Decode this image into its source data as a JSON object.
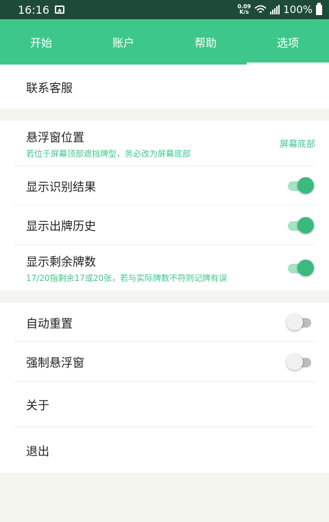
{
  "status_bar": {
    "time": "16:16",
    "speed_value": "0.09",
    "speed_unit": "K/s",
    "battery": "100%"
  },
  "tabs": [
    {
      "label": "开始"
    },
    {
      "label": "账户"
    },
    {
      "label": "帮助"
    },
    {
      "label": "选项"
    }
  ],
  "active_tab": 3,
  "section1": {
    "contact": "联系客服"
  },
  "section2": {
    "position_title": "悬浮窗位置",
    "position_hint": "若位于屏幕顶部遮挡牌型，务必改为屏幕底部",
    "position_value": "屏幕底部",
    "show_result": "显示识别结果",
    "show_result_on": true,
    "show_history": "显示出牌历史",
    "show_history_on": true,
    "show_remaining": "显示剩余牌数",
    "show_remaining_hint": "17/20指剩余17或20张，若与实际牌数不符则记牌有误",
    "show_remaining_on": true
  },
  "section3": {
    "auto_reset": "自动重置",
    "auto_reset_on": false,
    "force_float": "强制悬浮窗",
    "force_float_on": false,
    "about": "关于",
    "exit": "退出"
  },
  "colors": {
    "accent": "#3ec78b",
    "status_bar": "#1e4a3a",
    "background": "#f5f5f0"
  }
}
